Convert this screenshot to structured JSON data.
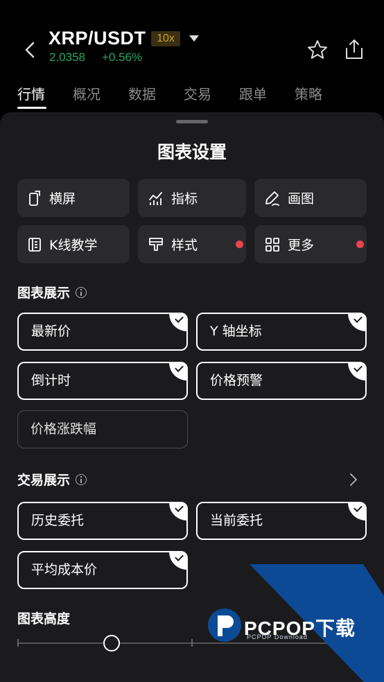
{
  "header": {
    "pair": "XRP/USDT",
    "leverage": "10x",
    "price": "2.0358",
    "change": "+0.56%",
    "colors": {
      "up": "#23a866",
      "leverage_bg": "#3a2f12",
      "leverage_text": "#c9a227"
    }
  },
  "tabs": [
    {
      "label": "行情",
      "active": true
    },
    {
      "label": "概况"
    },
    {
      "label": "数据"
    },
    {
      "label": "交易"
    },
    {
      "label": "跟单"
    },
    {
      "label": "策略"
    }
  ],
  "sheet": {
    "title": "图表设置",
    "tools": [
      {
        "label": "横屏",
        "icon": "rotate-screen-icon"
      },
      {
        "label": "指标",
        "icon": "indicator-icon"
      },
      {
        "label": "画图",
        "icon": "pen-icon"
      },
      {
        "label": "K线教学",
        "icon": "candle-book-icon"
      },
      {
        "label": "样式",
        "icon": "brush-icon",
        "badge": true
      },
      {
        "label": "更多",
        "icon": "grid-icon",
        "badge": true
      }
    ],
    "chart_display": {
      "title": "图表展示",
      "options": [
        {
          "label": "最新价",
          "checked": true
        },
        {
          "label": "Y 轴坐标",
          "checked": true
        },
        {
          "label": "倒计时",
          "checked": true
        },
        {
          "label": "价格预警",
          "checked": true
        },
        {
          "label": "价格涨跌幅",
          "checked": false
        }
      ]
    },
    "trade_display": {
      "title": "交易展示",
      "options": [
        {
          "label": "历史委托",
          "checked": true
        },
        {
          "label": "当前委托",
          "checked": true
        },
        {
          "label": "平均成本价",
          "checked": true
        }
      ]
    },
    "chart_height": {
      "title": "图表高度",
      "value_fraction": 0.27
    },
    "colors": {
      "badge": "#e8434f",
      "sheet_bg": "#1b1b1d",
      "tool_bg": "#2a2a2c"
    }
  },
  "watermark": {
    "text": "PCPOP下载",
    "sub": "PCPOP Download",
    "color": "#0d4a96"
  }
}
